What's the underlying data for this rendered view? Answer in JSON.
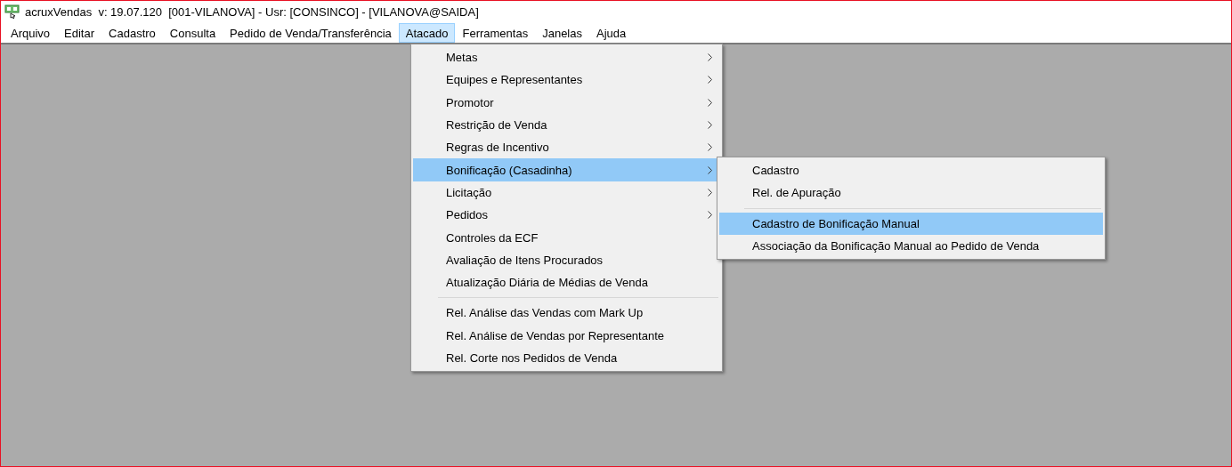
{
  "window": {
    "title": "acruxVendas  v: 19.07.120  [001-VILANOVA] - Usr: [CONSINCO] - [VILANOVA@SAIDA]"
  },
  "menubar": [
    {
      "label": "Arquivo",
      "selected": false
    },
    {
      "label": "Editar",
      "selected": false
    },
    {
      "label": "Cadastro",
      "selected": false
    },
    {
      "label": "Consulta",
      "selected": false
    },
    {
      "label": "Pedido de Venda/Transferência",
      "selected": false
    },
    {
      "label": "Atacado",
      "selected": true
    },
    {
      "label": "Ferramentas",
      "selected": false
    },
    {
      "label": "Janelas",
      "selected": false
    },
    {
      "label": "Ajuda",
      "selected": false
    }
  ],
  "menu": {
    "items": [
      {
        "kind": "item",
        "label": "Metas",
        "has_submenu": true,
        "selected": false
      },
      {
        "kind": "item",
        "label": "Equipes e Representantes",
        "has_submenu": true,
        "selected": false
      },
      {
        "kind": "item",
        "label": "Promotor",
        "has_submenu": true,
        "selected": false
      },
      {
        "kind": "item",
        "label": "Restrição de Venda",
        "has_submenu": true,
        "selected": false
      },
      {
        "kind": "item",
        "label": "Regras de Incentivo",
        "has_submenu": true,
        "selected": false
      },
      {
        "kind": "item",
        "label": "Bonificação (Casadinha)",
        "has_submenu": true,
        "selected": true
      },
      {
        "kind": "item",
        "label": "Licitação",
        "has_submenu": true,
        "selected": false
      },
      {
        "kind": "item",
        "label": "Pedidos",
        "has_submenu": true,
        "selected": false
      },
      {
        "kind": "item",
        "label": "Controles da ECF",
        "has_submenu": false,
        "selected": false
      },
      {
        "kind": "item",
        "label": "Avaliação de Itens Procurados",
        "has_submenu": false,
        "selected": false
      },
      {
        "kind": "item",
        "label": "Atualização Diária de Médias de Venda",
        "has_submenu": false,
        "selected": false
      },
      {
        "kind": "separator"
      },
      {
        "kind": "item",
        "label": "Rel. Análise das Vendas com Mark Up",
        "has_submenu": false,
        "selected": false
      },
      {
        "kind": "item",
        "label": "Rel. Análise de Vendas por Representante",
        "has_submenu": false,
        "selected": false
      },
      {
        "kind": "item",
        "label": "Rel. Corte nos Pedidos de Venda",
        "has_submenu": false,
        "selected": false
      }
    ]
  },
  "submenu": {
    "items": [
      {
        "kind": "item",
        "label": "Cadastro",
        "has_submenu": false,
        "selected": false
      },
      {
        "kind": "item",
        "label": "Rel. de Apuração",
        "has_submenu": false,
        "selected": false
      },
      {
        "kind": "separator"
      },
      {
        "kind": "item",
        "label": "Cadastro de Bonificação Manual",
        "has_submenu": false,
        "selected": true
      },
      {
        "kind": "item",
        "label": "Associação da Bonificação Manual ao Pedido de Venda",
        "has_submenu": false,
        "selected": false
      }
    ]
  }
}
